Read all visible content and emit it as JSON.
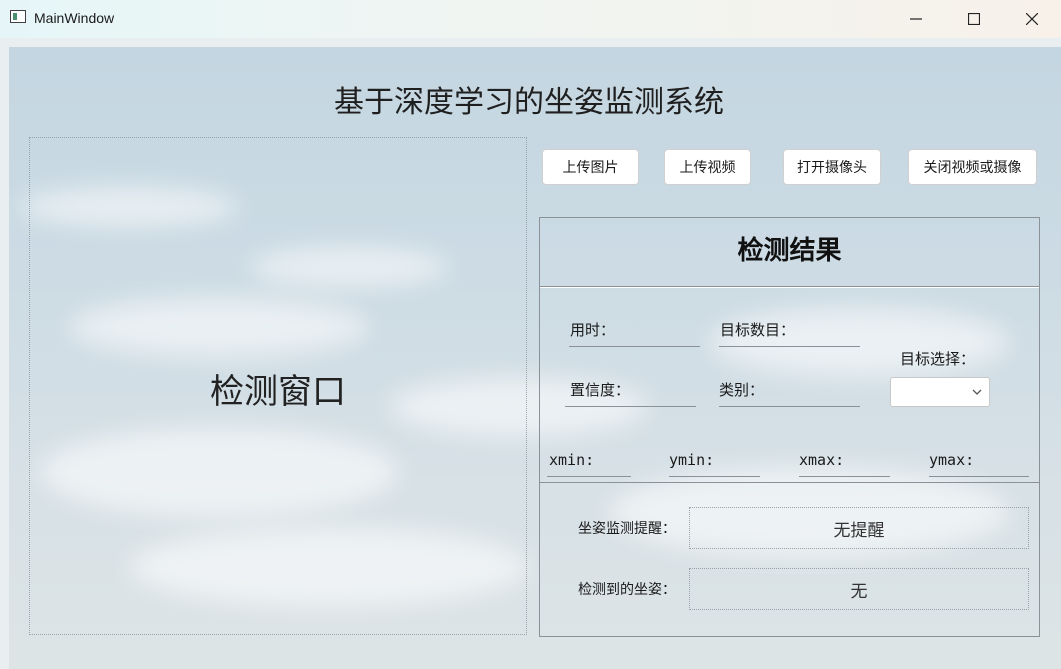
{
  "window": {
    "title": "MainWindow"
  },
  "app": {
    "title": "基于深度学习的坐姿监测系统"
  },
  "detection_window": {
    "label": "检测窗口"
  },
  "toolbar": {
    "upload_image": "上传图片",
    "upload_video": "上传视频",
    "open_camera": "打开摄像头",
    "close_video_camera": "关闭视频或摄像"
  },
  "results": {
    "title": "检测结果",
    "time_label": "用时：",
    "target_count_label": "目标数目：",
    "confidence_label": "置信度：",
    "class_label": "类别：",
    "target_select_label": "目标选择：",
    "target_select_value": "",
    "xmin_label": "xmin:",
    "ymin_label": "ymin:",
    "xmax_label": "xmax:",
    "ymax_label": "ymax:",
    "posture_alert_label": "坐姿监测提醒：",
    "posture_alert_value": "无提醒",
    "detected_posture_label": "检测到的坐姿：",
    "detected_posture_value": "无"
  },
  "icons": [
    "app-icon",
    "minimize-icon",
    "maximize-icon",
    "close-icon",
    "chevron-down-icon"
  ]
}
